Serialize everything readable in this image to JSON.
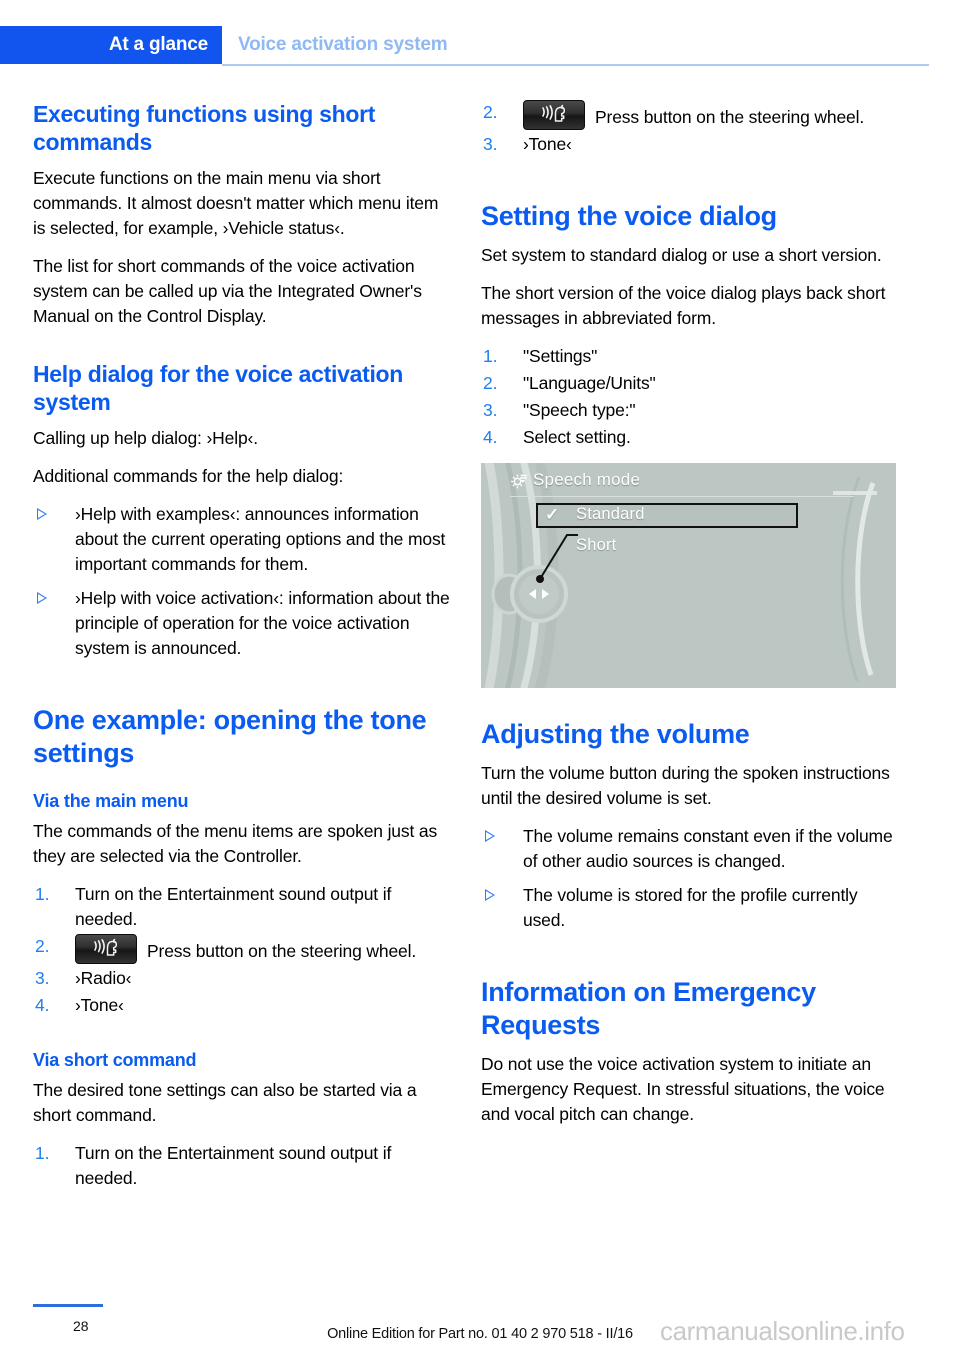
{
  "header": {
    "tab_label": "At a glance",
    "section_title": "Voice activation system",
    "accent_color": "#1155ee",
    "section_color": "#8fb9f4"
  },
  "left_column": {
    "section1": {
      "heading": "Executing functions using short commands",
      "paragraphs": [
        "Execute functions on the main menu via short commands. It almost doesn't matter which menu item is selected, for example, ›Vehicle status‹.",
        "The list for short commands of the voice activation system can be called up via the Integrated Owner's Manual on the Control Display."
      ]
    },
    "section2": {
      "heading": "Help dialog for the voice activation system",
      "paragraphs": [
        "Calling up help dialog: ›Help‹.",
        "Additional commands for the help dialog:"
      ],
      "bullets": [
        "›Help with examples‹: announces information about the current operating options and the most important commands for them.",
        "›Help with voice activation‹: information about the principle of operation for the voice activation system is announced."
      ]
    },
    "section3": {
      "heading": "One example: opening the tone settings",
      "sub1": {
        "heading": "Via the main menu",
        "paragraph": "The commands of the menu items are spoken just as they are selected via the Controller.",
        "steps": [
          {
            "num": "1.",
            "text": "Turn on the Entertainment sound output if needed.",
            "icon": null
          },
          {
            "num": "2.",
            "text": "Press button on the steering wheel.",
            "icon": "voice-button-icon"
          },
          {
            "num": "3.",
            "text": "›Radio‹",
            "icon": null
          },
          {
            "num": "4.",
            "text": "›Tone‹",
            "icon": null
          }
        ]
      },
      "sub2": {
        "heading": "Via short command",
        "paragraph": "The desired tone settings can also be started via a short command.",
        "steps": [
          {
            "num": "1.",
            "text": "Turn on the Entertainment sound output if needed.",
            "icon": null
          }
        ]
      }
    }
  },
  "right_column": {
    "continued_steps": [
      {
        "num": "2.",
        "text": "Press button on the steering wheel.",
        "icon": "voice-button-icon"
      },
      {
        "num": "3.",
        "text": "›Tone‹",
        "icon": null
      }
    ],
    "section4": {
      "heading": "Setting the voice dialog",
      "paragraphs": [
        "Set system to standard dialog or use a short version.",
        "The short version of the voice dialog plays back short messages in abbreviated form."
      ],
      "steps": [
        {
          "num": "1.",
          "text": "\"Settings\""
        },
        {
          "num": "2.",
          "text": "\"Language/Units\""
        },
        {
          "num": "3.",
          "text": "\"Speech type:\""
        },
        {
          "num": "4.",
          "text": "Select setting."
        }
      ],
      "figure": {
        "title": "Speech mode",
        "gear_icon": "gear-icon",
        "options": [
          {
            "label": "Standard",
            "selected": true,
            "check": "✓"
          },
          {
            "label": "Short",
            "selected": false,
            "check": ""
          }
        ],
        "background_color": "#bcc7c4",
        "callout_target": "steering-wheel-toggle"
      }
    },
    "section5": {
      "heading": "Adjusting the volume",
      "paragraph": "Turn the volume button during the spoken instructions until the desired volume is set.",
      "bullets": [
        "The volume remains constant even if the volume of other audio sources is changed.",
        "The volume is stored for the profile currently used."
      ]
    },
    "section6": {
      "heading": "Information on Emergency Requests",
      "paragraph": "Do not use the voice activation system to initiate an Emergency Request. In stressful situations, the voice and vocal pitch can change."
    }
  },
  "footer": {
    "page_number": "28",
    "edition_note": "Online Edition for Part no. 01 40 2 970 518 - II/16",
    "watermark": "carmanualsonline.info"
  }
}
